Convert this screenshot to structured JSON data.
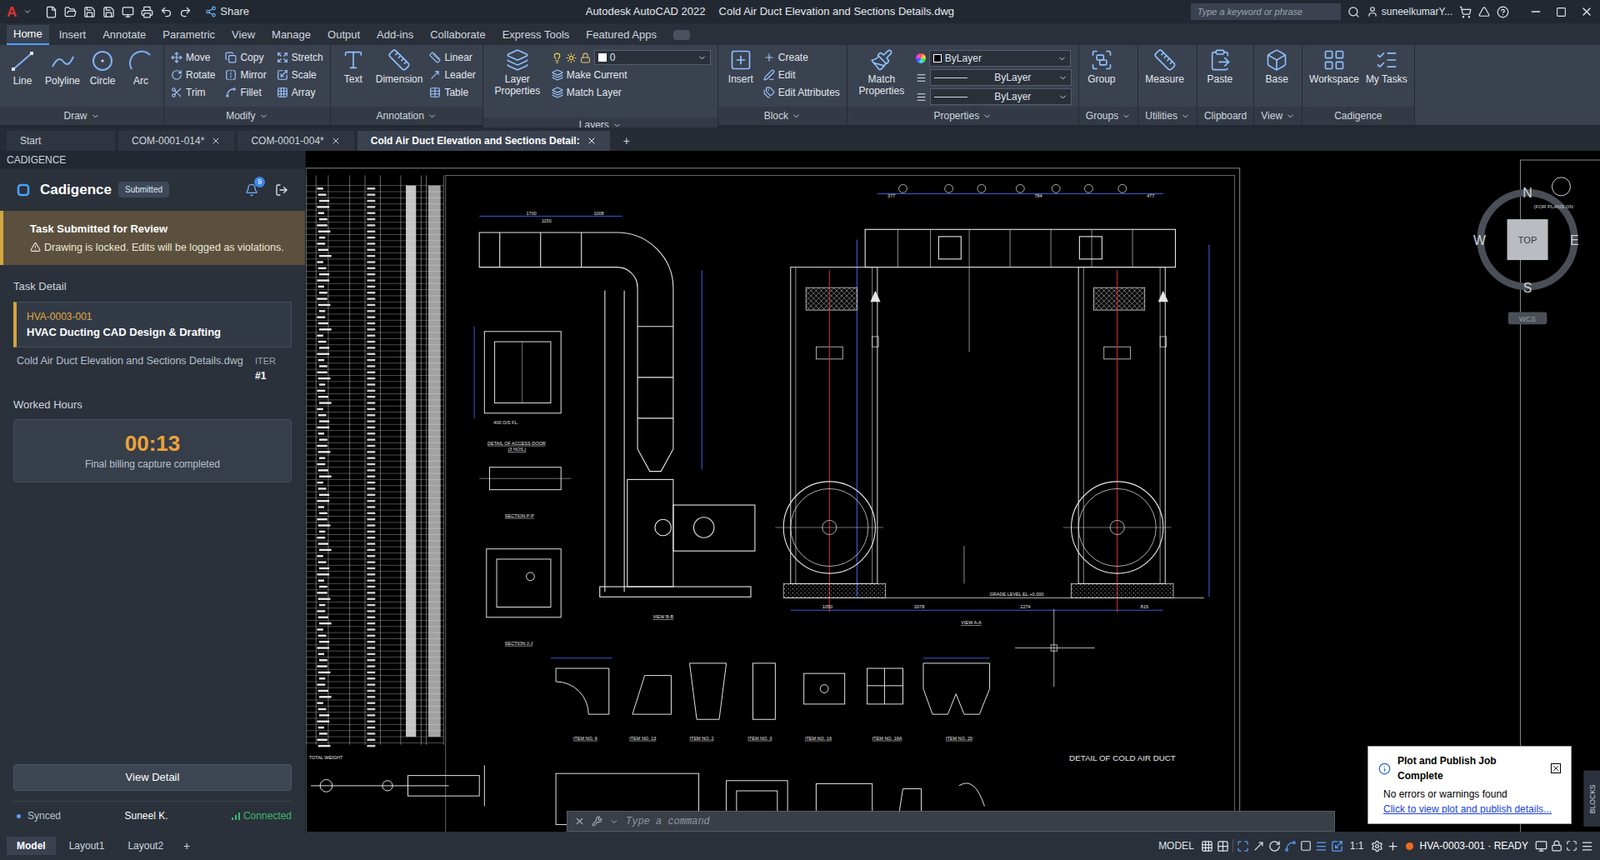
{
  "window": {
    "logo": "A",
    "app": "Autodesk AutoCAD 2022",
    "document": "Cold Air Duct Elevation and Sections Details.dwg",
    "share": "Share",
    "search_placeholder": "Type a keyword or phrase",
    "user": "suneelkumarY..."
  },
  "ribbon": {
    "tabs": [
      {
        "label": "Home",
        "selected": true
      },
      {
        "label": "Insert",
        "selected": false
      },
      {
        "label": "Annotate",
        "selected": false
      },
      {
        "label": "Parametric",
        "selected": false
      },
      {
        "label": "View",
        "selected": false
      },
      {
        "label": "Manage",
        "selected": false
      },
      {
        "label": "Output",
        "selected": false
      },
      {
        "label": "Add-ins",
        "selected": false
      },
      {
        "label": "Collaborate",
        "selected": false
      },
      {
        "label": "Express Tools",
        "selected": false
      },
      {
        "label": "Featured Apps",
        "selected": false
      }
    ],
    "panels": [
      {
        "title": "Draw",
        "expand": true,
        "large": [
          "Line",
          "Polyline",
          "Circle",
          "Arc"
        ],
        "small": []
      },
      {
        "title": "Modify",
        "expand": true,
        "large": [],
        "small": [
          "Move",
          "Rotate",
          "Trim",
          "Copy",
          "Mirror",
          "Fillet",
          "Stretch",
          "Scale",
          "Array"
        ]
      },
      {
        "title": "Annotation",
        "expand": true,
        "large": [
          "Text",
          "Dimension"
        ],
        "small": [
          "Linear",
          "Leader",
          "Table"
        ]
      },
      {
        "title": "Layers",
        "expand": true,
        "large": [
          "Layer Properties"
        ],
        "small": [
          "Make Current",
          "Match Layer"
        ],
        "dropdown": "0"
      },
      {
        "title": "Block",
        "expand": true,
        "large": [
          "Insert"
        ],
        "small": [
          "Create",
          "Edit",
          "Edit Attributes"
        ]
      },
      {
        "title": "Properties",
        "expand": true,
        "large": [
          "Match Properties"
        ],
        "small": [],
        "properties": [
          "ByLayer",
          "ByLayer",
          "ByLayer"
        ]
      },
      {
        "title": "Groups",
        "expand": true,
        "large": [
          "Group"
        ],
        "small": []
      },
      {
        "title": "Utilities",
        "expand": true,
        "large": [
          "Measure"
        ],
        "small": []
      },
      {
        "title": "Clipboard",
        "expand": false,
        "large": [
          "Paste"
        ],
        "small": []
      },
      {
        "title": "View",
        "expand": true,
        "large": [
          "Base"
        ],
        "small": []
      },
      {
        "title": "Cadigence",
        "expand": false,
        "large": [
          "Workspace",
          "My Tasks"
        ],
        "small": []
      }
    ]
  },
  "doc_tabs": {
    "tabs": [
      {
        "label": "Start",
        "selected": false,
        "closable": false
      },
      {
        "label": "COM-0001-014*",
        "selected": false,
        "closable": true
      },
      {
        "label": "COM-0001-004*",
        "selected": false,
        "closable": true
      },
      {
        "label": "Cold Air Duct Elevation and Sections Detail:",
        "selected": true,
        "closable": true
      }
    ],
    "add": "+"
  },
  "sidebar": {
    "header": "CADIGENCE",
    "brand": "Cadigence",
    "badge": "Submitted",
    "notifications": "9",
    "alert": {
      "title": "Task Submitted for Review",
      "body": "Drawing is locked. Edits will be logged as violations."
    },
    "task_heading": "Task Detail",
    "task_code": "HVA-0003-001",
    "task_name": "HVAC Ducting CAD Design & Drafting",
    "file": "Cold Air Duct Elevation and Sections Details.dwg",
    "iter_label": "ITER",
    "iter_value": "#1",
    "hours_heading": "Worked Hours",
    "hours": "00:13",
    "hours_note": "Final billing capture completed",
    "button": "View Detail",
    "sync": "Synced",
    "user": "Suneel K.",
    "connection": "Connected"
  },
  "drawing": {
    "labels": [
      "DETAIL OF ACCESS DOOR",
      "(3 NOS.)",
      "SECTION P-P",
      "SECTION J-J",
      "VIEW B-B",
      "VIEW A-A",
      "GRADE LEVEL EL.+0.000",
      "DETAIL OF COLD AIR DUCT",
      "ITEM NO. 6",
      "ITEM NO. 13",
      "ITEM NO. 2",
      "ITEM NO. 3",
      "ITEM NO. 16",
      "ITEM NO. 16A",
      "ITEM NO. 20",
      "TOTAL WEIGHT"
    ],
    "dimensions": [
      "1700",
      "1150",
      "1008",
      "377",
      "784",
      "477",
      "1050",
      "2078",
      "2274",
      "815",
      "400 O/S FL."
    ]
  },
  "viewcube": {
    "north": "N",
    "south": "S",
    "east": "E",
    "west": "W",
    "face": "TOP",
    "ucs": "WCS",
    "note": "(FOR PLANS ON"
  },
  "blocks_tab": "BLOCKS",
  "command": {
    "placeholder": "Type a command"
  },
  "notification": {
    "title": "Plot and Publish Job Complete",
    "body": "No errors or warnings found",
    "link": "Click to view plot and publish details..."
  },
  "status_bar": {
    "layouts": [
      {
        "label": "Model",
        "selected": true
      },
      {
        "label": "Layout1",
        "selected": false
      },
      {
        "label": "Layout2",
        "selected": false
      }
    ],
    "add": "+",
    "space": "MODEL",
    "scale": "1:1",
    "task": "HVA-0003-001 · READY"
  }
}
